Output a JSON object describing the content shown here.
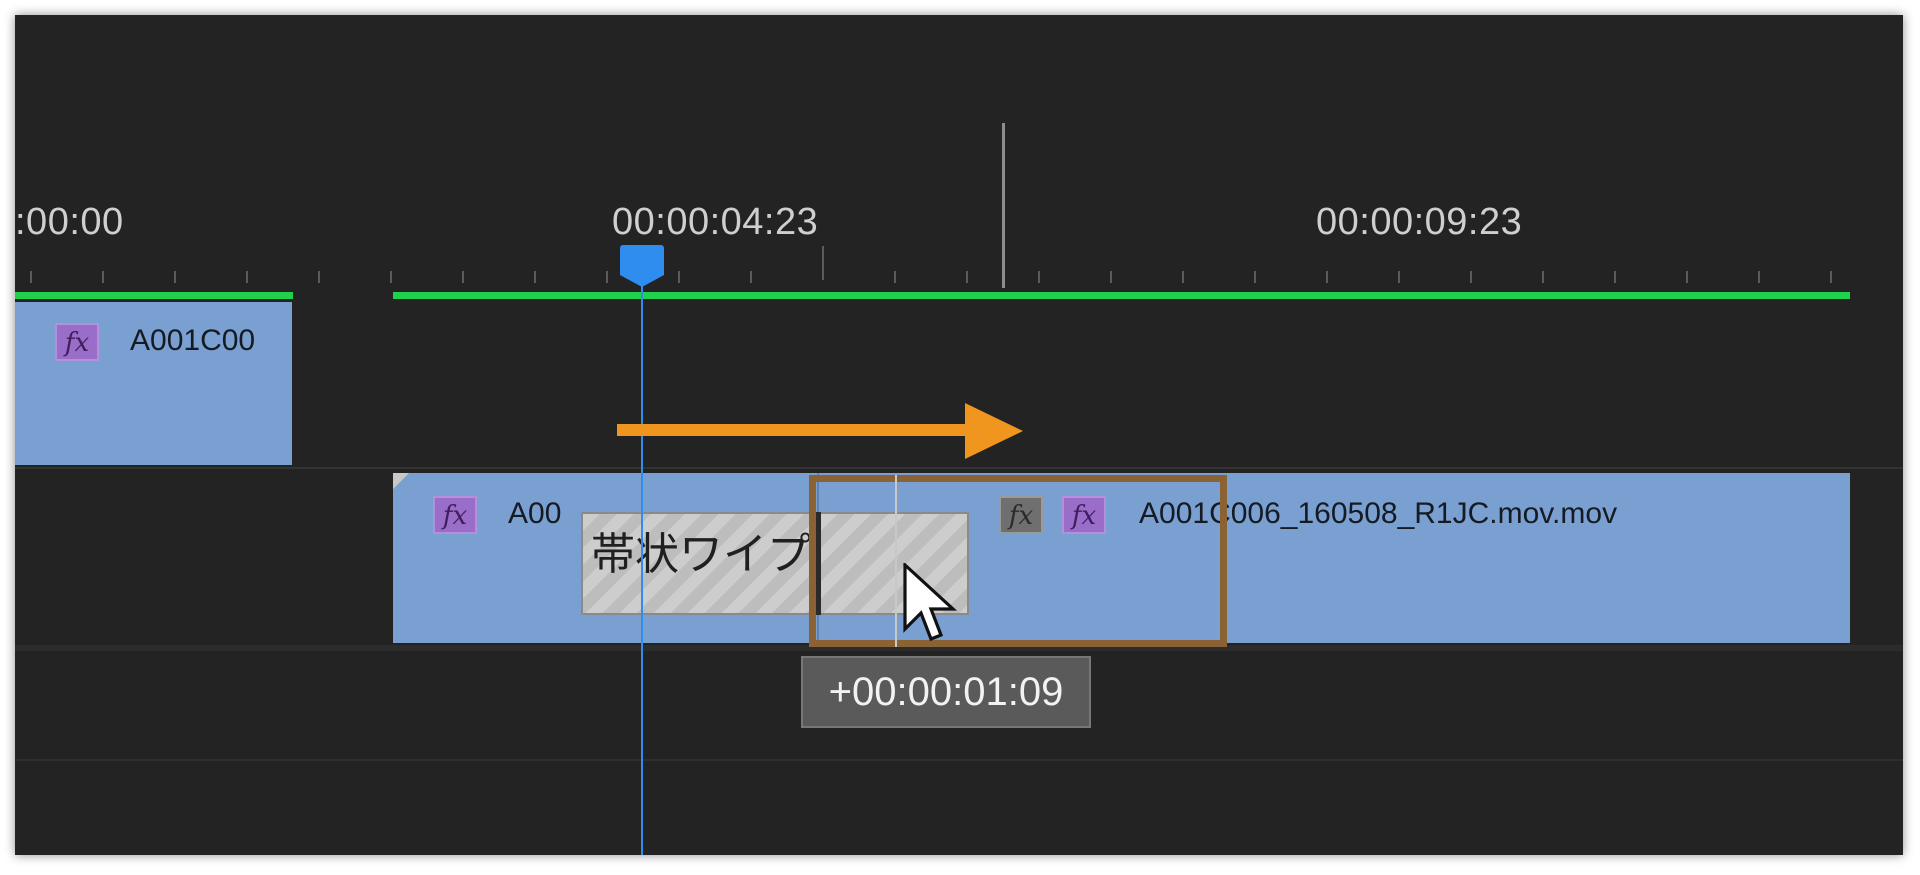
{
  "ruler": {
    "labels": [
      ":00:00",
      "00:00:04:23",
      "00:00:09:23"
    ]
  },
  "clips": {
    "v2": {
      "name": "A001C00",
      "fx": "fx"
    },
    "v1_left": {
      "name": "A00",
      "fx": "fx"
    },
    "v1_right": {
      "name": "A001C006_160508_R1JC.mov.mov",
      "fx_gray": "fx",
      "fx": "fx"
    }
  },
  "transition": {
    "label": "帯状ワイプ"
  },
  "tooltip": {
    "offset": "+00:00:01:09"
  },
  "colors": {
    "panel_bg": "#232323",
    "clip_blue": "#7aa0d2",
    "playhead": "#2f8df0",
    "work_area_bar": "#1fd14b",
    "drag_outline": "#8a6233",
    "annotation_arrow": "#f0961e",
    "fx_badge": "#9a6dc8"
  },
  "icons": {
    "cursor": "mouse-pointer-icon",
    "annotation": "right-arrow-icon"
  }
}
